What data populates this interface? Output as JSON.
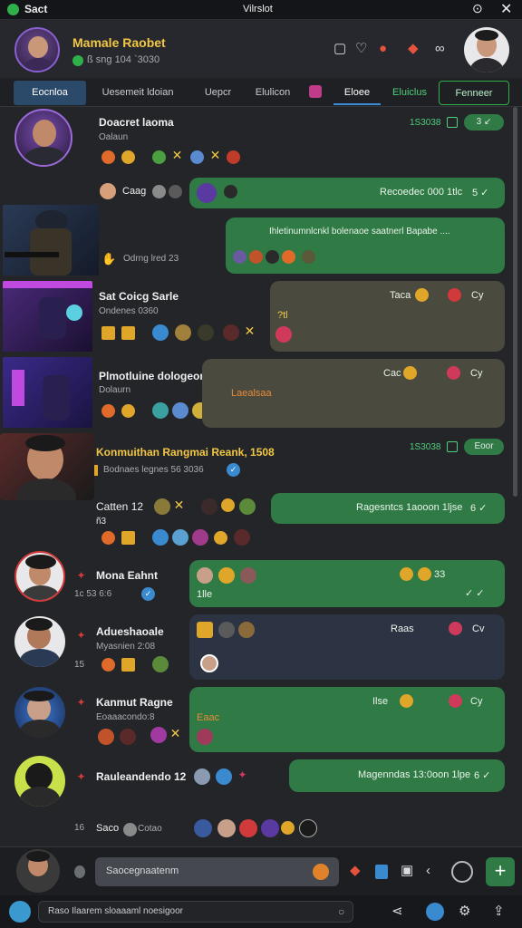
{
  "titlebar": {
    "app_name": "Sact",
    "title": "Vilrslot"
  },
  "header": {
    "name": "Mamale Raobet",
    "status": "ß sng 104 `3030"
  },
  "tabs": [
    {
      "label": "Eocnloa"
    },
    {
      "label": "Uesemeit ldoian"
    },
    {
      "label": "Uepcr"
    },
    {
      "label": "Elulicon"
    },
    {
      "label": "Eloee"
    },
    {
      "label": "Eluiclus"
    },
    {
      "label": "Fenneer"
    }
  ],
  "messages": [
    {
      "name": "Doacret laoma",
      "sub": "Oalaun",
      "time": "1S3038",
      "badge": "3 ↙"
    },
    {
      "name": "Caag",
      "bubble": "Recoedec 000 1tlc",
      "check": "5 ✓"
    },
    {
      "meta": "Odrng lred 23",
      "bubble": "Ihletinumnlcnkl bolenaoe saatnerl Bapabe ...."
    },
    {
      "name": "Sat Coicg Sarle",
      "sub": "Ondenes 0360",
      "bubble_time": "Taca",
      "bubble_extra": "?tl",
      "bubble_meta": "Cy"
    },
    {
      "name": "Plmotluine dologeon",
      "sub": "Dolaurn",
      "bubble_time": "Cac",
      "bubble_text": "Laealsaa",
      "bubble_meta": "Cy"
    },
    {
      "name": "Konmuithan Rangmai Reank, 1508",
      "sub": "Bodnaes legnes 56 3036",
      "time": "1S3038",
      "badge": "Eoor"
    },
    {
      "name": "Catten 12",
      "sub": "ñ3",
      "bubble": "Ragesntcs 1aooon 1ljse",
      "check": "6 ✓"
    },
    {
      "name": "Mona Eahnt",
      "sub": "1c 53 6:6",
      "bubble_sub": "1lle",
      "bubble_meta": "33"
    },
    {
      "name": "Adueshaoale",
      "sub": "Myasnien 2:08",
      "row": "15",
      "bubble_time": "Raas",
      "bubble_meta": "Cv"
    },
    {
      "name": "Kanmut Ragne",
      "sub": "Eoaaacondo:8",
      "bubble_time": "Ilse",
      "bubble_text": "Eaac",
      "bubble_meta": "Cy"
    },
    {
      "name": "Rauleandendo 12",
      "bubble": "Magenndas 13:0oon 1lpe",
      "check": "6 ✓"
    },
    {
      "name": "Saco",
      "meta": "Cotao",
      "row": "16"
    }
  ],
  "composer": {
    "placeholder": "Saocegnaatenm"
  },
  "statusbar": {
    "text": "Raso Ilaarem sloaaaml noesigoor"
  }
}
